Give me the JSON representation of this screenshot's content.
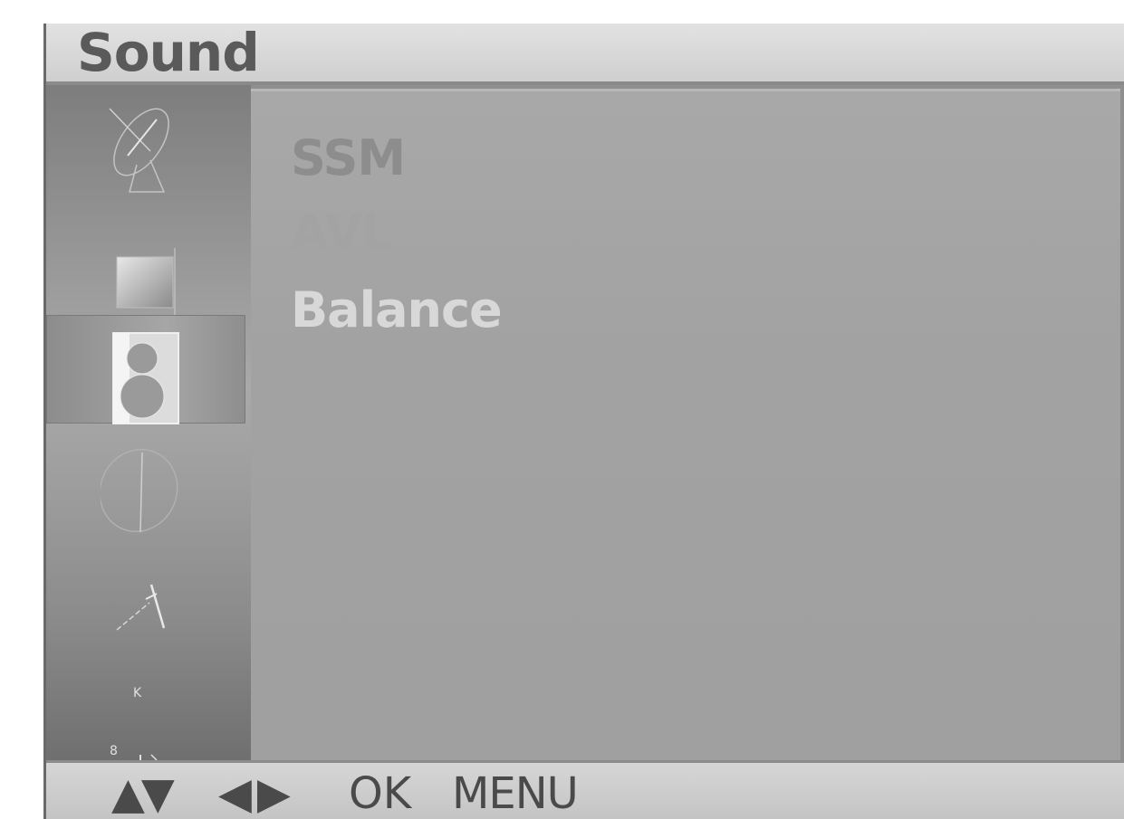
{
  "title": "Sound",
  "sidebar": {
    "icons": [
      "satellite-dish-icon",
      "picture-icon",
      "speaker-icon",
      "globe-icon",
      "tools-icon",
      "timer-icon"
    ],
    "active_index": 2
  },
  "menu": {
    "items": [
      {
        "label": "SSM"
      },
      {
        "label": "AVL"
      },
      {
        "label": "Balance"
      }
    ]
  },
  "footer": {
    "updown": "▲▼",
    "leftright": "◀▶",
    "ok": "OK",
    "menu": "MENU"
  }
}
